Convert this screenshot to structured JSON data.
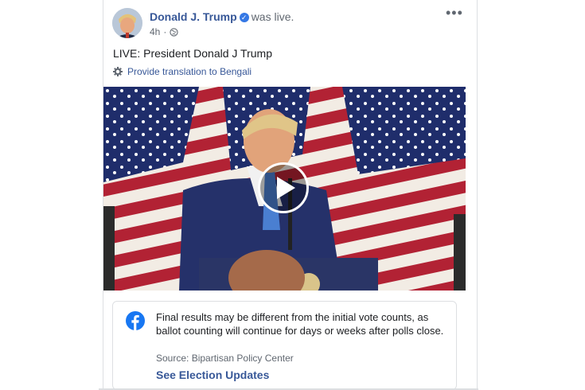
{
  "post": {
    "author": "Donald J. Trump",
    "status_text": "was live.",
    "time": "4h",
    "more_label": "•••",
    "text": "LIVE: President Donald J Trump",
    "translate_label": "Provide translation to Bengali",
    "icons": {
      "verified": "check-badge-icon",
      "audience": "globe-icon",
      "translate": "gear-icon",
      "play": "play-icon",
      "info_logo": "facebook-logo-icon"
    }
  },
  "info_box": {
    "message": "Final results may be different from the initial vote counts, as ballot counting will continue for days or weeks after polls close.",
    "source": "Source: Bipartisan Policy Center",
    "cta": "See Election Updates"
  },
  "colors": {
    "link": "#385898",
    "brand": "#1877f2",
    "secondary_text": "#606770",
    "border": "#dddfe2"
  }
}
